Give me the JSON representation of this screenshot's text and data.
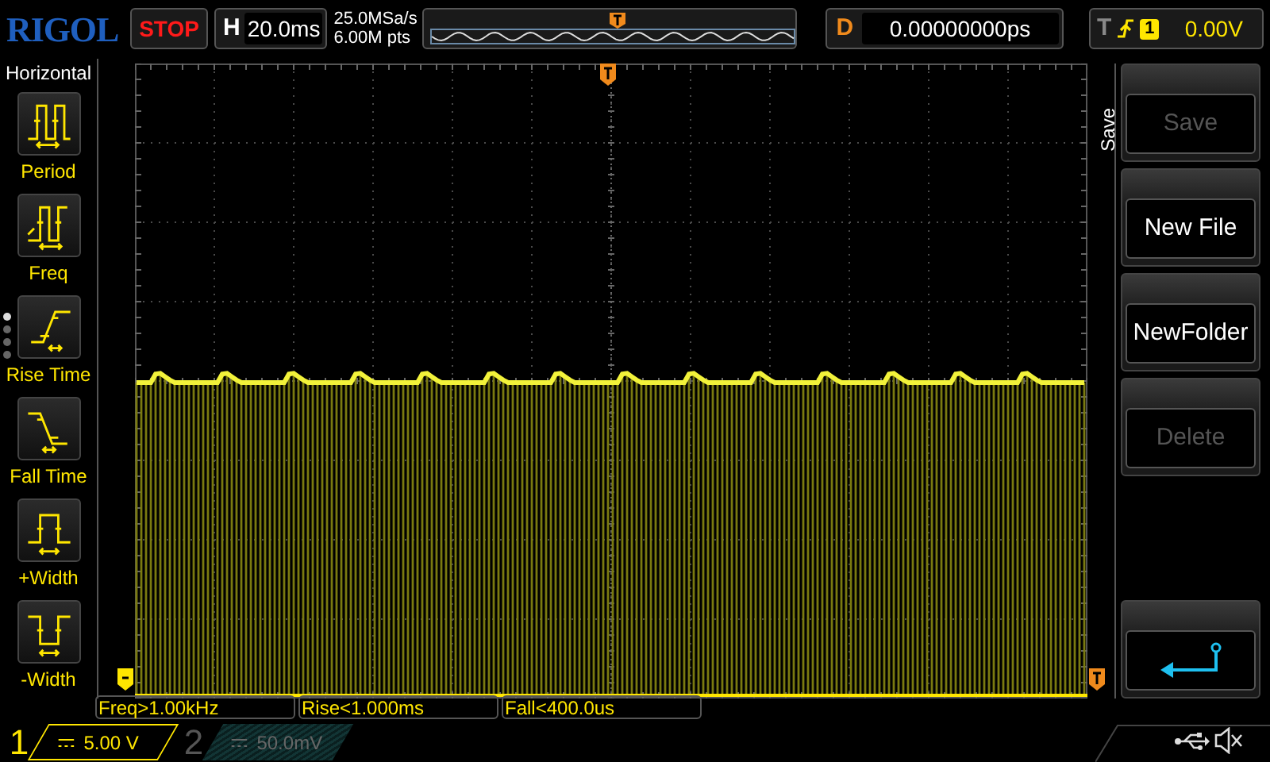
{
  "brand": "RIGOL",
  "run_state": "STOP",
  "horizontal": {
    "label": "H",
    "timebase": "20.0ms"
  },
  "acquisition": {
    "sample_rate": "25.0MSa/s",
    "memory_depth": "6.00M pts"
  },
  "delay": {
    "label": "D",
    "value": "0.00000000ps"
  },
  "trigger": {
    "label": "T",
    "source": "1",
    "level": "0.00V"
  },
  "left_menu": {
    "title": "Horizontal",
    "items": [
      {
        "kind": "period",
        "label": "Period"
      },
      {
        "kind": "freq",
        "label": "Freq"
      },
      {
        "kind": "rise",
        "label": "Rise Time"
      },
      {
        "kind": "fall",
        "label": "Fall Time"
      },
      {
        "kind": "pwidth",
        "label": "+Width"
      },
      {
        "kind": "nwidth",
        "label": "-Width"
      }
    ],
    "pages": [
      {
        "selected": true
      },
      {
        "selected": false
      },
      {
        "selected": false
      },
      {
        "selected": false
      }
    ]
  },
  "right_menu": {
    "title": "Save",
    "buttons": [
      {
        "kind": "text",
        "label": "Save",
        "disabled": true
      },
      {
        "kind": "text",
        "label": "New File",
        "disabled": false
      },
      {
        "kind": "text",
        "label": "NewFolder",
        "disabled": false
      },
      {
        "kind": "text",
        "label": "Delete",
        "disabled": true
      },
      {
        "kind": "back"
      }
    ]
  },
  "measurements": [
    "Freq>1.00kHz",
    "Rise<1.000ms",
    "Fall<400.0us"
  ],
  "channels": [
    {
      "number": "1",
      "scale": "5.00 V",
      "on": true
    },
    {
      "number": "2",
      "scale": "50.0mV",
      "on": false
    }
  ]
}
